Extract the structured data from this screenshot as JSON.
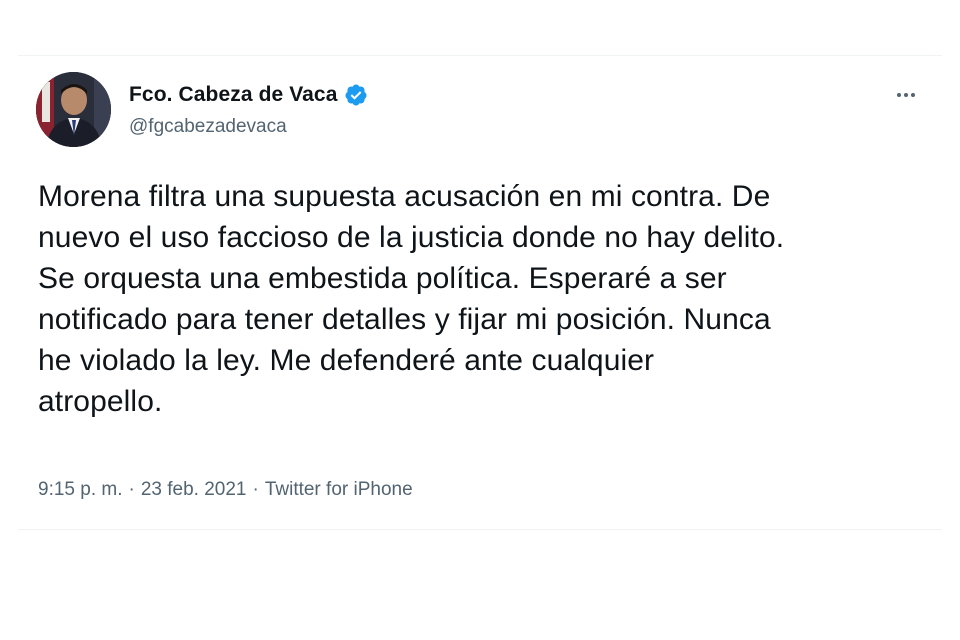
{
  "tweet": {
    "author": {
      "display_name": "Fco. Cabeza de Vaca",
      "handle": "@fgcabezadevaca",
      "verified": true
    },
    "text": "Morena filtra una supuesta acusación en mi contra. De\nnuevo el uso faccioso de la justicia donde no hay delito.\nSe orquesta una embestida política. Esperaré a ser\nnotificado para tener detalles y fijar mi posición. Nunca\nhe violado la ley. Me defenderé ante cualquier\natropello.",
    "time": "9:15 p. m.",
    "separator": "·",
    "date": "23 feb. 2021",
    "source": "Twitter for iPhone"
  },
  "icons": {
    "verified": "verified-badge-icon",
    "more": "more-options-icon"
  },
  "colors": {
    "text_primary": "#0f1419",
    "text_secondary": "#536471",
    "verified_blue": "#1d9bf0",
    "divider": "#eff3f4"
  }
}
